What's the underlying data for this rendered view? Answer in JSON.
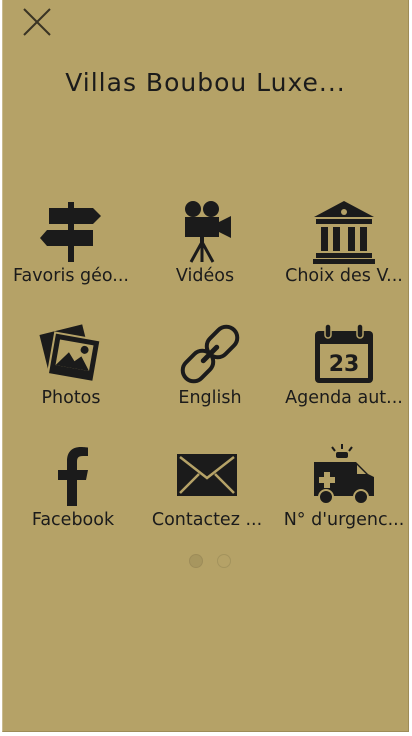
{
  "header": {
    "title": "Villas Boubou Luxe...",
    "close_icon": "close-icon"
  },
  "menu": {
    "items": [
      {
        "label": "Favoris géo...",
        "icon": "signpost-icon"
      },
      {
        "label": "Vidéos",
        "icon": "movie-camera-icon"
      },
      {
        "label": "Choix des V...",
        "icon": "building-icon"
      },
      {
        "label": "Photos",
        "icon": "photos-icon"
      },
      {
        "label": "English",
        "icon": "link-icon"
      },
      {
        "label": "Agenda aut...",
        "icon": "calendar-icon"
      },
      {
        "label": "Facebook",
        "icon": "facebook-icon"
      },
      {
        "label": "Contactez ...",
        "icon": "envelope-icon"
      },
      {
        "label": "N° d'urgenc...",
        "icon": "ambulance-icon"
      }
    ],
    "calendar_day": "23"
  },
  "pager": {
    "pages": 2,
    "current": 1
  },
  "colors": {
    "background": "#b5a267",
    "foreground": "#1b1b1b"
  }
}
